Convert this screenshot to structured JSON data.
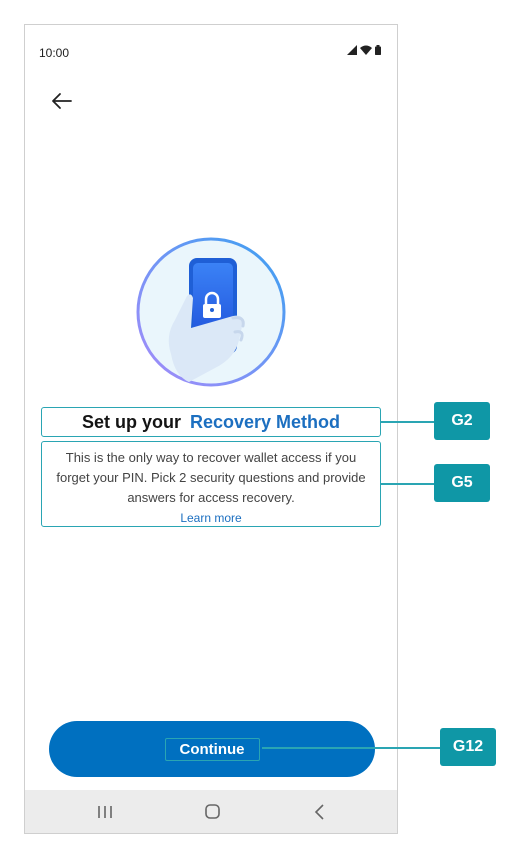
{
  "status_bar": {
    "time": "10:00"
  },
  "screen": {
    "title_plain": "Set up your",
    "title_highlight": "Recovery Method",
    "description": "This is the only way to recover wallet access if you forget your PIN. Pick 2 security questions and provide answers for access recovery.",
    "learn_more": "Learn more",
    "continue_label": "Continue"
  },
  "annotations": {
    "tag_title": "G2",
    "tag_description": "G5",
    "tag_continue": "G12"
  },
  "icons": {
    "back": "arrow-left-icon",
    "signal": "signal-icon",
    "wifi": "wifi-icon",
    "battery": "battery-icon",
    "hero": "phone-lock-illustration",
    "nav_recents": "recent-apps-icon",
    "nav_home": "home-icon",
    "nav_back": "chevron-left-icon"
  },
  "colors": {
    "accent": "#1c6fc0",
    "button": "#0070c0",
    "annotation": "#0f97a6",
    "outline": "#2aa5b3"
  }
}
